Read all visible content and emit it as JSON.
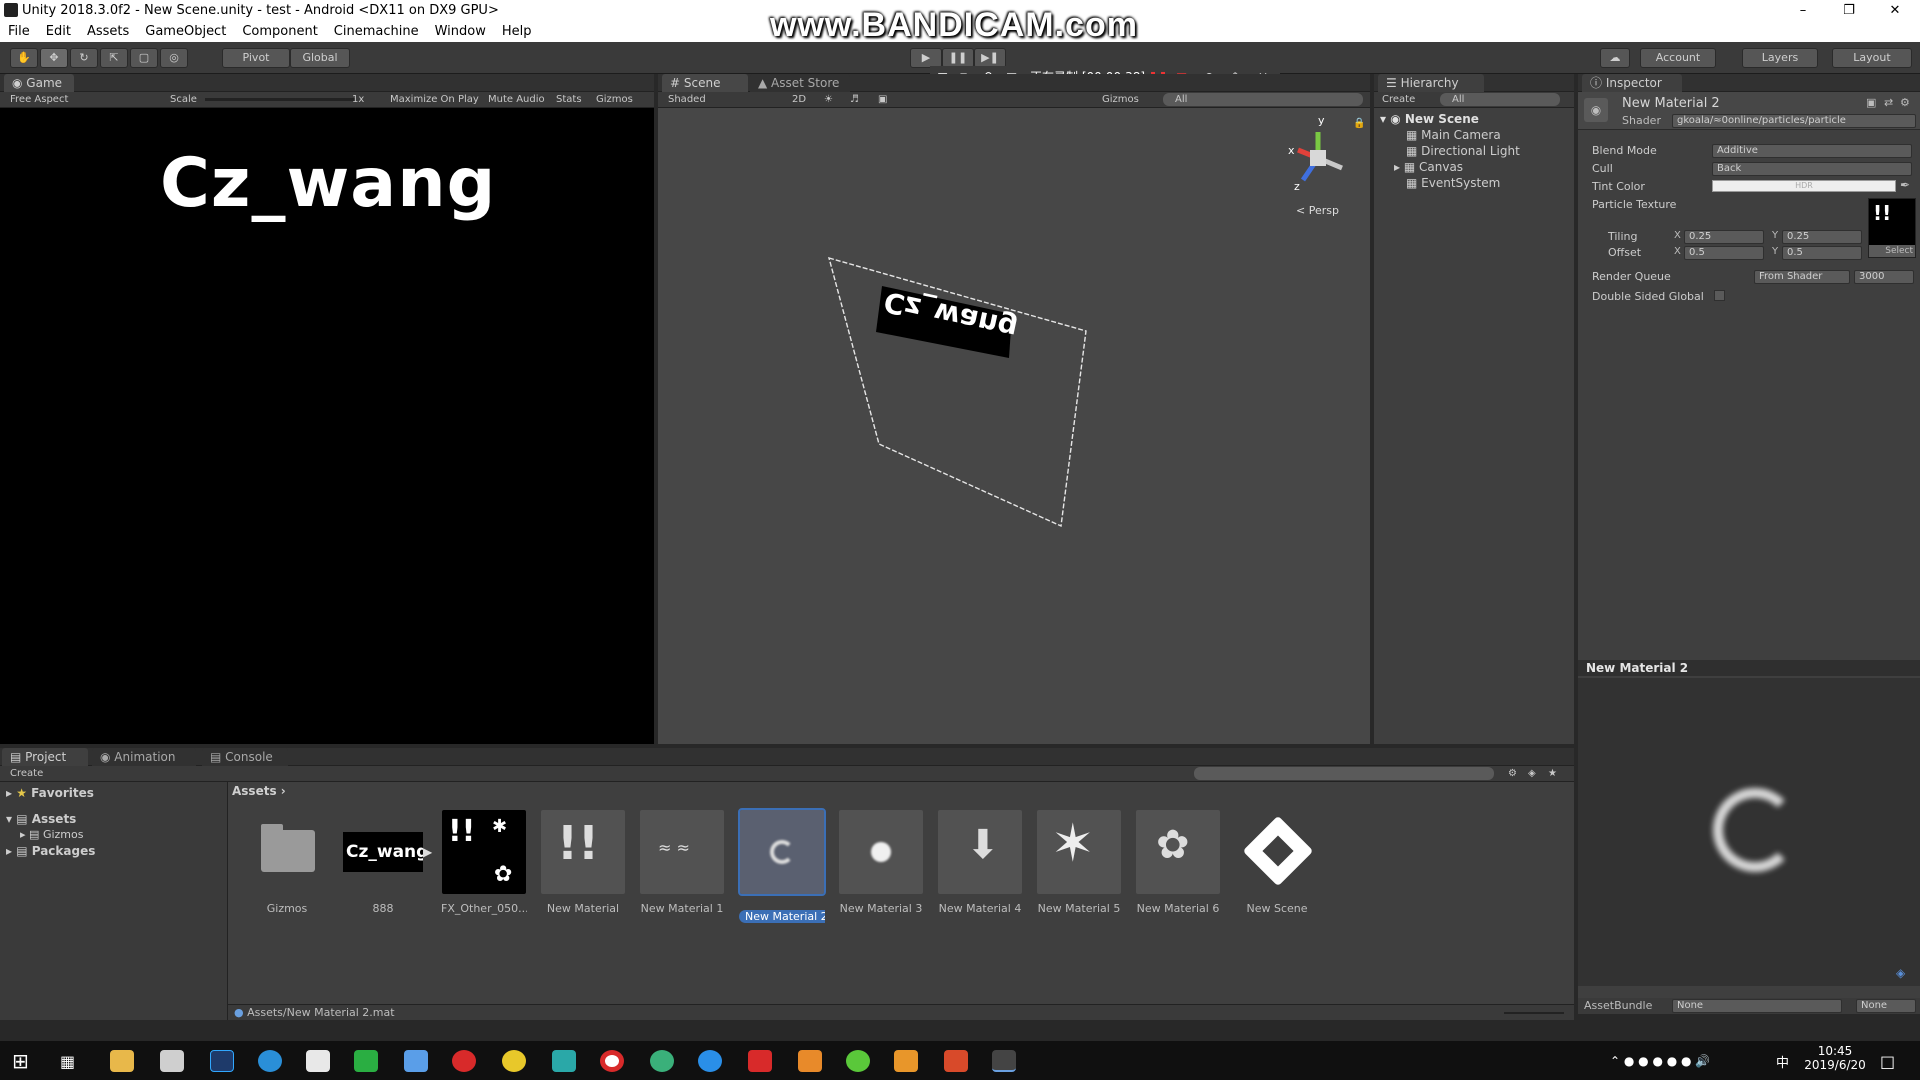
{
  "window": {
    "title": "Unity 2018.3.0f2 - New Scene.unity - test - Android <DX11 on DX9 GPU>"
  },
  "watermark": "www.BANDICAM.com",
  "menu": [
    "File",
    "Edit",
    "Assets",
    "GameObject",
    "Component",
    "Cinemachine",
    "Window",
    "Help"
  ],
  "toolbar": {
    "pivot": "Pivot",
    "global": "Global",
    "account": "Account",
    "layers": "Layers",
    "layout": "Layout"
  },
  "recording": {
    "status": "正在录制 [00:00:38]"
  },
  "game": {
    "tab": "Game",
    "aspect": "Free Aspect",
    "scale_label": "Scale",
    "scale_value": "1x",
    "maximize": "Maximize On Play",
    "mute": "Mute Audio",
    "stats": "Stats",
    "gizmos": "Gizmos",
    "display_text": "Cz_wang"
  },
  "scene": {
    "tab": "Scene",
    "asset_store_tab": "Asset Store",
    "shading": "Shaded",
    "mode_2d": "2D",
    "gizmos": "Gizmos",
    "search": "All",
    "persp": "Persp",
    "quad_text": "Cz_wang",
    "axis_x": "x",
    "axis_y": "y",
    "axis_z": "z"
  },
  "hierarchy": {
    "tab": "Hierarchy",
    "create": "Create",
    "search": "All",
    "scene_name": "New Scene",
    "items": [
      "Main Camera",
      "Directional Light",
      "Canvas",
      "EventSystem"
    ]
  },
  "inspector": {
    "tab": "Inspector",
    "material_name": "New Material 2",
    "shader_label": "Shader",
    "shader_value": "gkoala/≈0online/particles/particle",
    "blend_mode_label": "Blend Mode",
    "blend_mode_value": "Additive",
    "cull_label": "Cull",
    "cull_value": "Back",
    "tint_label": "Tint Color",
    "tint_hdr": "HDR",
    "texture_label": "Particle Texture",
    "select": "Select",
    "tiling_label": "Tiling",
    "offset_label": "Offset",
    "tiling_x": "0.25",
    "tiling_y": "0.25",
    "offset_x": "0.5",
    "offset_y": "0.5",
    "x_label": "X",
    "y_label": "Y",
    "render_queue_label": "Render Queue",
    "render_queue_mode": "From Shader",
    "render_queue_value": "3000",
    "double_sided_label": "Double Sided Global",
    "preview_title": "New Material 2",
    "assetbundle_label": "AssetBundle",
    "assetbundle_value": "None",
    "assetbundle_variant": "None"
  },
  "project": {
    "tabs": [
      "Project",
      "Animation",
      "Console"
    ],
    "create": "Create",
    "favorites": "Favorites",
    "assets_folder": "Assets",
    "gizmos_folder": "Gizmos",
    "packages_folder": "Packages",
    "breadcrumb": "Assets",
    "breadcrumb_arrow": "›",
    "assets": [
      {
        "name": "Gizmos"
      },
      {
        "name": "888"
      },
      {
        "name": "FX_Other_050..."
      },
      {
        "name": "New Material"
      },
      {
        "name": "New Material 1"
      },
      {
        "name": "New Material 2"
      },
      {
        "name": "New Material 3"
      },
      {
        "name": "New Material 4"
      },
      {
        "name": "New Material 5"
      },
      {
        "name": "New Material 6"
      },
      {
        "name": "New Scene"
      }
    ],
    "thumb_888_text": "Cz_wang",
    "status_path": "Assets/New Material 2.mat"
  },
  "taskbar": {
    "time": "10:45",
    "date": "2019/6/20",
    "ime": "中"
  }
}
